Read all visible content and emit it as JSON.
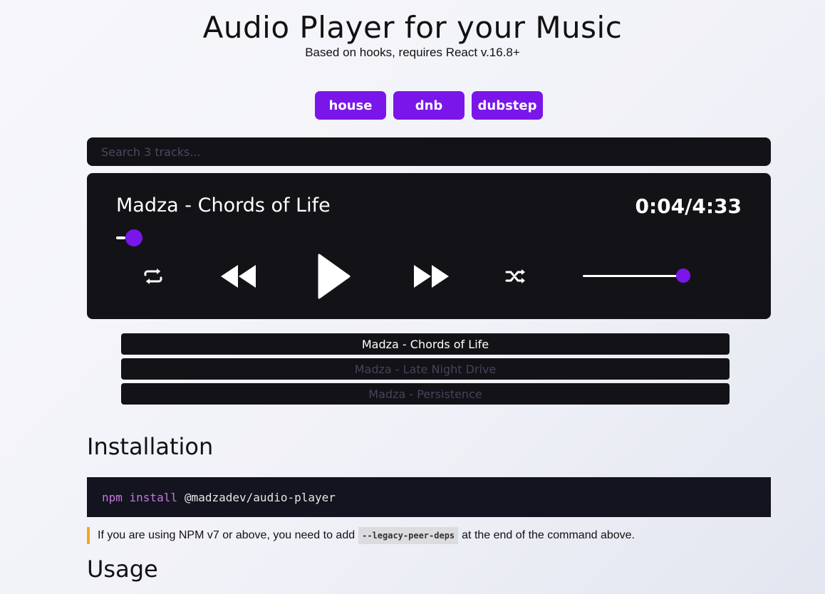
{
  "header": {
    "title": "Audio Player for your Music",
    "subtitle": "Based on hooks, requires React v.16.8+"
  },
  "tags": [
    "house",
    "dnb",
    "dubstep"
  ],
  "search": {
    "placeholder": "Search 3 tracks..."
  },
  "player": {
    "track_title": "Madza - Chords of Life",
    "time": "0:04/4:33",
    "progress_fraction": 0.015,
    "volume_fraction": 0.94,
    "icons": [
      "repeat-icon",
      "rewind-icon",
      "play-icon",
      "fast-forward-icon",
      "shuffle-icon"
    ]
  },
  "playlist": [
    {
      "title": "Madza - Chords of Life",
      "active": true
    },
    {
      "title": "Madza - Late Night Drive",
      "active": false
    },
    {
      "title": "Madza - Persistence",
      "active": false
    }
  ],
  "installation": {
    "heading": "Installation",
    "code_command": "npm install",
    "code_package": "@madzadev/audio-player",
    "note_before": "If you are using NPM v7 or above, you need to add",
    "note_code": "--legacy-peer-deps",
    "note_after": "at the end of the command above."
  },
  "usage": {
    "heading": "Usage"
  },
  "colors": {
    "accent": "#7a16ea",
    "player_bg": "#131217",
    "note_bar": "#f5a623"
  }
}
